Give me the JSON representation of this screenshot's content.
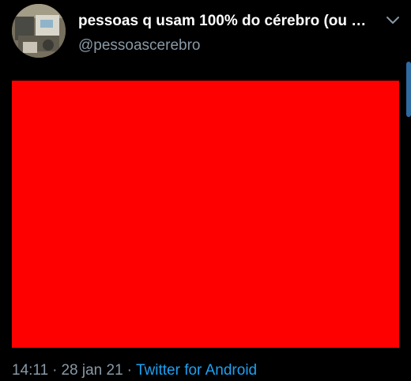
{
  "tweet": {
    "display_name": "pessoas q usam 100% do cérebro (ou n...",
    "handle": "@pessoascerebro",
    "time": "14:11",
    "separator": "·",
    "date": "28 jan 21",
    "source": "Twitter for Android",
    "media_color": "#ff0000"
  },
  "icons": {
    "menu": "chevron-down-icon",
    "avatar": "avatar-image"
  },
  "colors": {
    "background": "#000000",
    "secondary_text": "#8899a6",
    "link": "#1da1f2"
  }
}
